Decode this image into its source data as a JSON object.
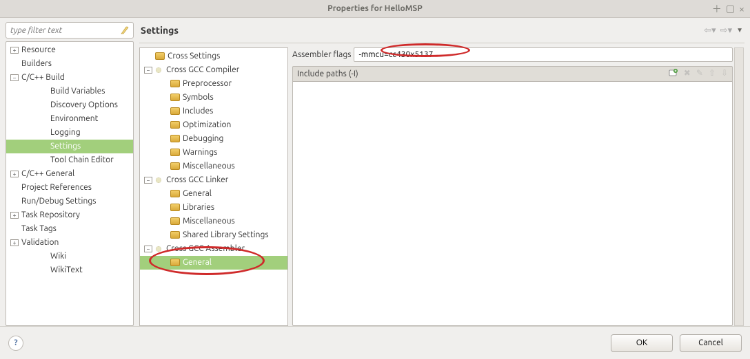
{
  "window": {
    "title": "Properties for HelloMSP"
  },
  "filter": {
    "placeholder": "type filter text"
  },
  "navTree": {
    "resource": "Resource",
    "builders": "Builders",
    "ccpp_build": "C/C++ Build",
    "build_vars": "Build Variables",
    "discovery": "Discovery Options",
    "environment": "Environment",
    "logging": "Logging",
    "settings": "Settings",
    "toolchain": "Tool Chain Editor",
    "ccpp_general": "C/C++ General",
    "proj_refs": "Project References",
    "rundebug": "Run/Debug Settings",
    "task_repo": "Task Repository",
    "task_tags": "Task Tags",
    "validation": "Validation",
    "wiki": "Wiki",
    "wikitext": "WikiText"
  },
  "heading": "Settings",
  "toolTree": {
    "root": "Cross Settings",
    "gcc_compiler": "Cross GCC Compiler",
    "preprocessor": "Preprocessor",
    "symbols": "Symbols",
    "includes": "Includes",
    "optimization": "Optimization",
    "debugging": "Debugging",
    "warnings": "Warnings",
    "miscellaneous": "Miscellaneous",
    "gcc_linker": "Cross GCC Linker",
    "general": "General",
    "libraries": "Libraries",
    "miscellaneous2": "Miscellaneous",
    "shared_lib": "Shared Library Settings",
    "gcc_assembler": "Cross GCC Assembler",
    "general2": "General"
  },
  "form": {
    "flags_label": "Assembler flags",
    "flags_value": "-mmcu=cc430x5137",
    "include_label": "Include paths (-I)"
  },
  "buttons": {
    "ok": "OK",
    "cancel": "Cancel"
  }
}
